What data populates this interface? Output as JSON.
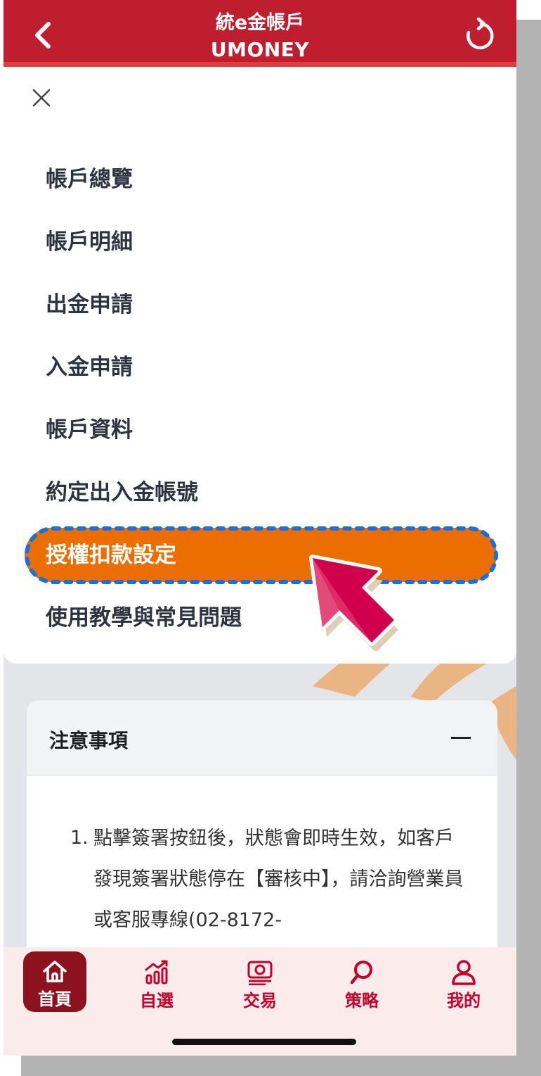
{
  "header": {
    "title": "統e金帳戶",
    "subtitle": "UMONEY"
  },
  "menu": {
    "items": [
      {
        "label": "帳戶總覽"
      },
      {
        "label": "帳戶明細"
      },
      {
        "label": "出金申請"
      },
      {
        "label": "入金申請"
      },
      {
        "label": "帳戶資料"
      },
      {
        "label": "約定出入金帳號"
      },
      {
        "label": "授權扣款設定",
        "selected": true
      },
      {
        "label": "使用教學與常見問題"
      }
    ]
  },
  "notes": {
    "title": "注意事項",
    "item_number": "1.",
    "item_text": "點擊簽署按鈕後，狀態會即時生效，如客戶發現簽署狀態停在【審核中】，請洽詢營業員或客服專線(02-8172-"
  },
  "tabbar": {
    "tabs": [
      {
        "label": "首頁",
        "icon": "home-icon",
        "active": true
      },
      {
        "label": "自選",
        "icon": "chart-icon"
      },
      {
        "label": "交易",
        "icon": "trade-icon"
      },
      {
        "label": "策略",
        "icon": "search-icon"
      },
      {
        "label": "我的",
        "icon": "user-icon"
      }
    ]
  },
  "colors": {
    "header_bg": "#bf1e2e",
    "highlight_bg": "#eb6e00",
    "tab_active_bg": "#8c1220",
    "tab_text": "#c3002b"
  }
}
